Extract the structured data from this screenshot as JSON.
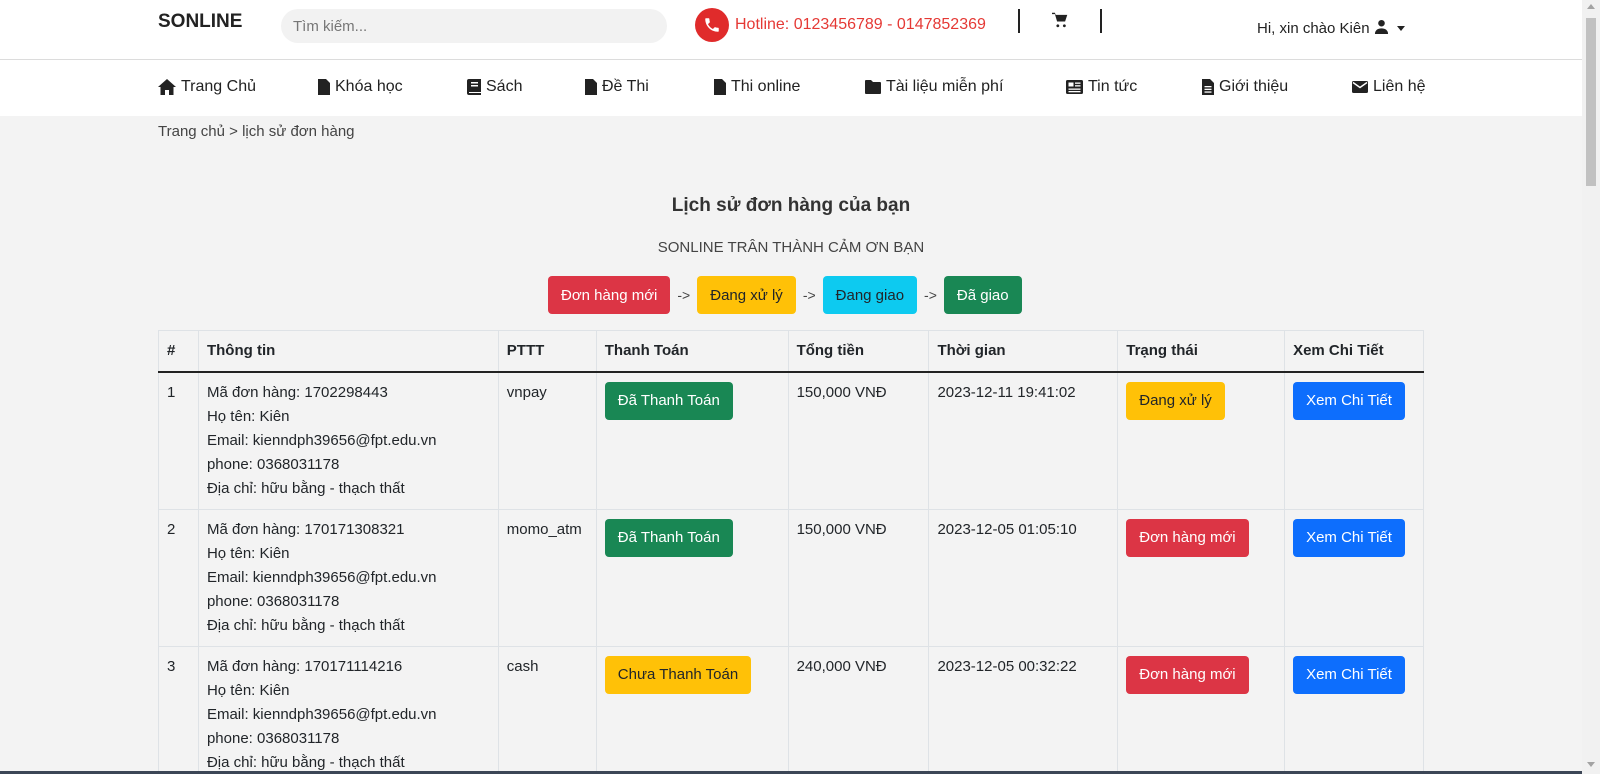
{
  "header": {
    "brand": "SONLINE",
    "search_placeholder": "Tìm kiếm...",
    "hotline": "Hotline: 0123456789 - 0147852369",
    "greeting": "Hi, xin chào Kiên"
  },
  "nav": [
    {
      "label": "Trang Chủ",
      "icon": "home-icon"
    },
    {
      "label": "Khóa học",
      "icon": "file-icon"
    },
    {
      "label": "Sách",
      "icon": "book-icon"
    },
    {
      "label": "Đề Thi",
      "icon": "file-icon"
    },
    {
      "label": "Thi online",
      "icon": "file-icon"
    },
    {
      "label": "Tài liệu miễn phí",
      "icon": "folder-icon"
    },
    {
      "label": "Tin tức",
      "icon": "newspaper-icon"
    },
    {
      "label": "Giới thiệu",
      "icon": "file-text-icon"
    },
    {
      "label": "Liên hệ",
      "icon": "envelope-icon"
    }
  ],
  "breadcrumb": "Trang chủ > lịch sử đơn hàng",
  "page": {
    "title": "Lịch sử đơn hàng của bạn",
    "subtitle": "SONLINE TRÂN THÀNH CẢM ƠN BẠN"
  },
  "status_flow": {
    "steps": [
      "Đơn hàng mới",
      "Đang xử lý",
      "Đang giao",
      "Đã giao"
    ],
    "arrow": "->"
  },
  "table": {
    "headers": [
      "#",
      "Thông tin",
      "PTTT",
      "Thanh Toán",
      "Tổng tiền",
      "Thời gian",
      "Trạng thái",
      "Xem Chi Tiết"
    ],
    "rows": [
      {
        "num": "1",
        "info": [
          "Mã đơn hàng: 1702298443",
          "Họ tên: Kiên",
          "Email: kienndph39656@fpt.edu.vn",
          "phone: 0368031178",
          "Địa chỉ: hữu bằng - thạch thất"
        ],
        "pttt": "vnpay",
        "payment": "Đã Thanh Toán",
        "total": "150,000 VNĐ",
        "time": "2023-12-11 19:41:02",
        "status": "Đang xử lý",
        "view": "Xem Chi Tiết"
      },
      {
        "num": "2",
        "info": [
          "Mã đơn hàng: 170171308321",
          "Họ tên: Kiên",
          "Email: kienndph39656@fpt.edu.vn",
          "phone: 0368031178",
          "Địa chỉ: hữu bằng - thạch thất"
        ],
        "pttt": "momo_atm",
        "payment": "Đã Thanh Toán",
        "total": "150,000 VNĐ",
        "time": "2023-12-05 01:05:10",
        "status": "Đơn hàng mới",
        "view": "Xem Chi Tiết"
      },
      {
        "num": "3",
        "info": [
          "Mã đơn hàng: 170171114216",
          "Họ tên: Kiên",
          "Email: kienndph39656@fpt.edu.vn",
          "phone: 0368031178",
          "Địa chỉ: hữu bằng - thạch thất"
        ],
        "pttt": "cash",
        "payment": "Chưa Thanh Toán",
        "total": "240,000 VNĐ",
        "time": "2023-12-05 00:32:22",
        "status": "Đơn hàng mới",
        "view": "Xem Chi Tiết"
      }
    ]
  },
  "colors": {
    "new": "#dc3545",
    "processing": "#ffc107",
    "shipping": "#0dcaf0",
    "delivered": "#198754",
    "paid": "#198754",
    "unpaid": "#ffc107",
    "view": "#0d6efd",
    "hotline": "#e53935"
  }
}
